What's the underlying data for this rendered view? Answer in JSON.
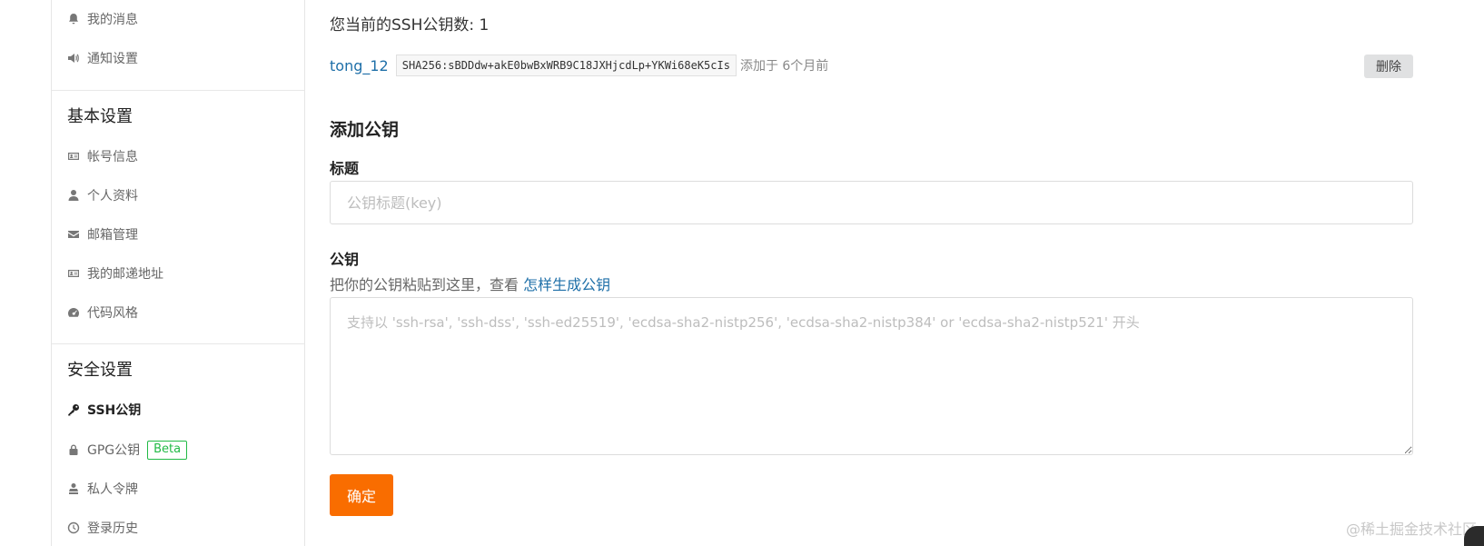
{
  "sidebar": {
    "items_top": [
      {
        "label": "我的消息",
        "icon": "bell-icon"
      },
      {
        "label": "通知设置",
        "icon": "speaker-icon"
      }
    ],
    "basic_title": "基本设置",
    "basic_items": [
      {
        "label": "帐号信息",
        "icon": "id-card-icon"
      },
      {
        "label": "个人资料",
        "icon": "user-icon"
      },
      {
        "label": "邮箱管理",
        "icon": "envelope-icon"
      },
      {
        "label": "我的邮递地址",
        "icon": "address-card-icon"
      },
      {
        "label": "代码风格",
        "icon": "dashboard-icon"
      }
    ],
    "security_title": "安全设置",
    "security_items": [
      {
        "label": "SSH公钥",
        "icon": "key-icon",
        "active": true
      },
      {
        "label": "GPG公钥",
        "icon": "lock-icon",
        "badge": "Beta"
      },
      {
        "label": "私人令牌",
        "icon": "token-icon"
      }
    ],
    "partial_item": {
      "label": "登录历史",
      "icon": "history-icon"
    }
  },
  "main": {
    "count_text": "您当前的SSH公钥数: 1",
    "key": {
      "name": "tong_12",
      "fingerprint": "SHA256:sBDDdw+akE0bwBxWRB9C18JXHjcdLp+YKWi68eK5cIs",
      "added": "添加于 6个月前",
      "delete_label": "删除"
    },
    "add_heading": "添加公钥",
    "title_label": "标题",
    "title_placeholder": "公钥标题(key)",
    "key_label": "公钥",
    "hint_text": "把你的公钥粘贴到这里，查看 ",
    "hint_link": "怎样生成公钥",
    "key_placeholder": "支持以 'ssh-rsa', 'ssh-dss', 'ssh-ed25519', 'ecdsa-sha2-nistp256', 'ecdsa-sha2-nistp384' or 'ecdsa-sha2-nistp521' 开头",
    "confirm_label": "确定"
  },
  "watermark": "@稀土掘金技术社区",
  "colors": {
    "accent": "#f96d00",
    "link": "#1e6fa8",
    "beta": "#21ba45",
    "delete_bg": "#e0e1e2"
  }
}
